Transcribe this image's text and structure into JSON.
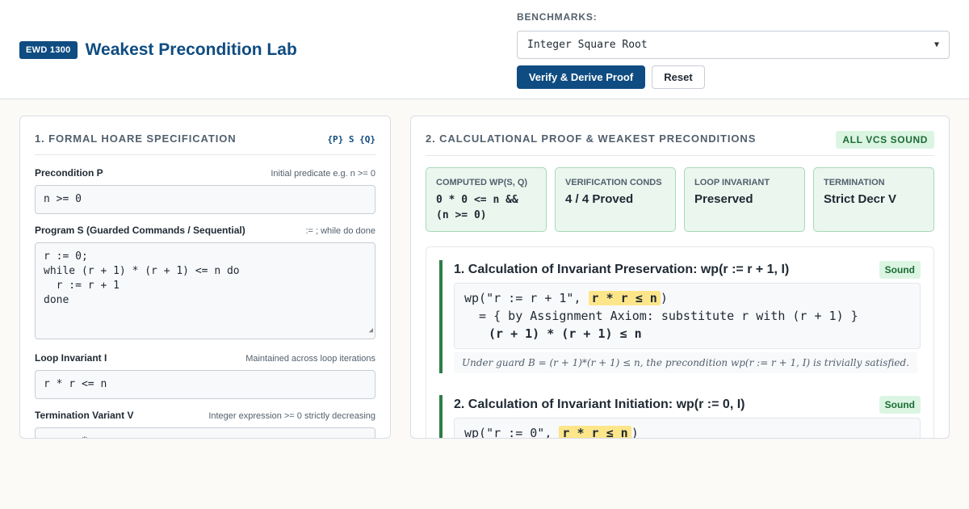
{
  "header": {
    "badge": "EWD 1300",
    "title": "Weakest Precondition Lab",
    "benchmarks_label": "BENCHMARKS:",
    "benchmark_selected": "Integer Square Root",
    "verify_label": "Verify & Derive Proof",
    "reset_label": "Reset"
  },
  "spec_panel": {
    "title": "1. FORMAL HOARE SPECIFICATION",
    "tag": "{P} S {Q}",
    "precondition": {
      "label": "Precondition P",
      "hint": "Initial predicate e.g. n >= 0",
      "value": "n >= 0"
    },
    "program": {
      "label": "Program S (Guarded Commands / Sequential)",
      "hint": ":= ; while do done",
      "value": "r := 0;\nwhile (r + 1) * (r + 1) <= n do\n  r := r + 1\ndone"
    },
    "invariant": {
      "label": "Loop Invariant I",
      "hint": "Maintained across loop iterations",
      "value": "r * r <= n"
    },
    "variant": {
      "label": "Termination Variant V",
      "hint": "Integer expression >= 0 strictly decreasing",
      "value": "n - r * r"
    }
  },
  "proof_panel": {
    "title": "2. CALCULATIONAL PROOF & WEAKEST PRECONDITIONS",
    "status": "ALL VCS SOUND",
    "stats": [
      {
        "label": "COMPUTED WP(S, Q)",
        "value": "0 * 0 <= n &&\n(n >= 0)"
      },
      {
        "label": "VERIFICATION CONDS",
        "value": "4 / 4 Proved"
      },
      {
        "label": "LOOP INVARIANT",
        "value": "Preserved"
      },
      {
        "label": "TERMINATION",
        "value": "Strict Decr V"
      }
    ],
    "steps": [
      {
        "title": "1. Calculation of Invariant Preservation: wp(r := r + 1, I)",
        "badge": "Sound",
        "wp_prefix": "wp(\"r := r + 1\", ",
        "wp_hl": "r * r ≤ n",
        "wp_suffix": ")",
        "line2": "  = { by Assignment Axiom: substitute r with (r + 1) }",
        "line3": "(r + 1) * (r + 1) ≤ n",
        "note": "Under guard B = (r + 1)*(r + 1) ≤ n, the precondition wp(r := r + 1, I) is trivially satisfied."
      },
      {
        "title": "2. Calculation of Invariant Initiation: wp(r := 0, I)",
        "badge": "Sound",
        "wp_prefix": "wp(\"r := 0\", ",
        "wp_hl": "r * r ≤ n",
        "wp_suffix": ")"
      }
    ]
  },
  "colors": {
    "brand": "#0f4c81",
    "success": "#2f7d46",
    "highlight": "#fde68a"
  }
}
